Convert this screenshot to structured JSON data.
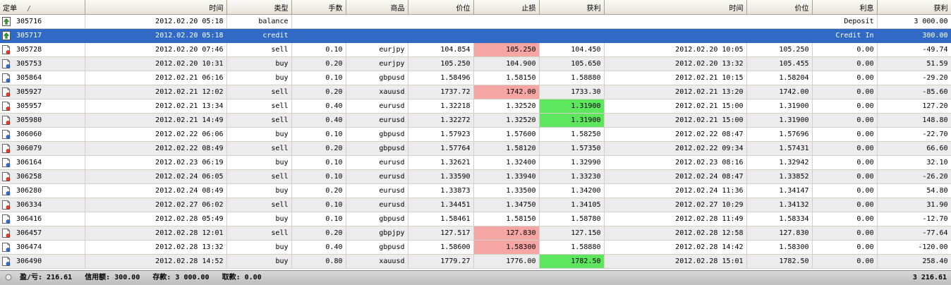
{
  "columns": [
    "定单",
    "时间",
    "类型",
    "手数",
    "商品",
    "价位",
    "止损",
    "获利",
    "时间",
    "价位",
    "利息",
    "获利"
  ],
  "sort_indicator": "/",
  "rows": [
    {
      "icon": "balance",
      "order": "305716",
      "open_time": "2012.02.20 05:18",
      "type": "balance",
      "comment": "Deposit",
      "swap": "",
      "profit": "3 000.00"
    },
    {
      "icon": "balance",
      "order": "305717",
      "open_time": "2012.02.20 05:18",
      "type": "credit",
      "comment": "Credit In",
      "swap": "",
      "profit": "300.00",
      "selected": true
    },
    {
      "icon": "sell",
      "order": "305728",
      "open_time": "2012.02.20 07:46",
      "type": "sell",
      "lots": "0.10",
      "symbol": "eurjpy",
      "price": "104.854",
      "sl": "105.250",
      "tp": "104.450",
      "close_time": "2012.02.20 10:05",
      "close_price": "105.250",
      "swap": "0.00",
      "profit": "-49.74",
      "sl_hl": "red"
    },
    {
      "icon": "buy",
      "order": "305753",
      "open_time": "2012.02.20 10:31",
      "type": "buy",
      "lots": "0.20",
      "symbol": "eurjpy",
      "price": "105.250",
      "sl": "104.900",
      "tp": "105.650",
      "close_time": "2012.02.20 13:32",
      "close_price": "105.455",
      "swap": "0.00",
      "profit": "51.59"
    },
    {
      "icon": "buy",
      "order": "305864",
      "open_time": "2012.02.21 06:16",
      "type": "buy",
      "lots": "0.10",
      "symbol": "gbpusd",
      "price": "1.58496",
      "sl": "1.58150",
      "tp": "1.58880",
      "close_time": "2012.02.21 10:15",
      "close_price": "1.58204",
      "swap": "0.00",
      "profit": "-29.20"
    },
    {
      "icon": "sell",
      "order": "305927",
      "open_time": "2012.02.21 12:02",
      "type": "sell",
      "lots": "0.20",
      "symbol": "xauusd",
      "price": "1737.72",
      "sl": "1742.00",
      "tp": "1733.30",
      "close_time": "2012.02.21 13:20",
      "close_price": "1742.00",
      "swap": "0.00",
      "profit": "-85.60",
      "sl_hl": "red"
    },
    {
      "icon": "sell",
      "order": "305957",
      "open_time": "2012.02.21 13:34",
      "type": "sell",
      "lots": "0.40",
      "symbol": "eurusd",
      "price": "1.32218",
      "sl": "1.32520",
      "tp": "1.31900",
      "close_time": "2012.02.21 15:00",
      "close_price": "1.31900",
      "swap": "0.00",
      "profit": "127.20",
      "tp_hl": "green"
    },
    {
      "icon": "sell",
      "order": "305980",
      "open_time": "2012.02.21 14:49",
      "type": "sell",
      "lots": "0.40",
      "symbol": "eurusd",
      "price": "1.32272",
      "sl": "1.32520",
      "tp": "1.31900",
      "close_time": "2012.02.21 15:00",
      "close_price": "1.31900",
      "swap": "0.00",
      "profit": "148.80",
      "tp_hl": "green"
    },
    {
      "icon": "buy",
      "order": "306060",
      "open_time": "2012.02.22 06:06",
      "type": "buy",
      "lots": "0.10",
      "symbol": "gbpusd",
      "price": "1.57923",
      "sl": "1.57600",
      "tp": "1.58250",
      "close_time": "2012.02.22 08:47",
      "close_price": "1.57696",
      "swap": "0.00",
      "profit": "-22.70"
    },
    {
      "icon": "sell",
      "order": "306079",
      "open_time": "2012.02.22 08:49",
      "type": "sell",
      "lots": "0.20",
      "symbol": "gbpusd",
      "price": "1.57764",
      "sl": "1.58120",
      "tp": "1.57350",
      "close_time": "2012.02.22 09:34",
      "close_price": "1.57431",
      "swap": "0.00",
      "profit": "66.60"
    },
    {
      "icon": "buy",
      "order": "306164",
      "open_time": "2012.02.23 06:19",
      "type": "buy",
      "lots": "0.10",
      "symbol": "eurusd",
      "price": "1.32621",
      "sl": "1.32400",
      "tp": "1.32990",
      "close_time": "2012.02.23 08:16",
      "close_price": "1.32942",
      "swap": "0.00",
      "profit": "32.10"
    },
    {
      "icon": "sell",
      "order": "306258",
      "open_time": "2012.02.24 06:05",
      "type": "sell",
      "lots": "0.10",
      "symbol": "eurusd",
      "price": "1.33590",
      "sl": "1.33940",
      "tp": "1.33230",
      "close_time": "2012.02.24 08:47",
      "close_price": "1.33852",
      "swap": "0.00",
      "profit": "-26.20"
    },
    {
      "icon": "buy",
      "order": "306280",
      "open_time": "2012.02.24 08:49",
      "type": "buy",
      "lots": "0.20",
      "symbol": "eurusd",
      "price": "1.33873",
      "sl": "1.33500",
      "tp": "1.34200",
      "close_time": "2012.02.24 11:36",
      "close_price": "1.34147",
      "swap": "0.00",
      "profit": "54.80"
    },
    {
      "icon": "sell",
      "order": "306334",
      "open_time": "2012.02.27 06:02",
      "type": "sell",
      "lots": "0.10",
      "symbol": "eurusd",
      "price": "1.34451",
      "sl": "1.34750",
      "tp": "1.34105",
      "close_time": "2012.02.27 10:29",
      "close_price": "1.34132",
      "swap": "0.00",
      "profit": "31.90"
    },
    {
      "icon": "buy",
      "order": "306416",
      "open_time": "2012.02.28 05:49",
      "type": "buy",
      "lots": "0.10",
      "symbol": "gbpusd",
      "price": "1.58461",
      "sl": "1.58150",
      "tp": "1.58780",
      "close_time": "2012.02.28 11:49",
      "close_price": "1.58334",
      "swap": "0.00",
      "profit": "-12.70"
    },
    {
      "icon": "sell",
      "order": "306457",
      "open_time": "2012.02.28 12:01",
      "type": "sell",
      "lots": "0.20",
      "symbol": "gbpjpy",
      "price": "127.517",
      "sl": "127.830",
      "tp": "127.150",
      "close_time": "2012.02.28 12:58",
      "close_price": "127.830",
      "swap": "0.00",
      "profit": "-77.64",
      "sl_hl": "red"
    },
    {
      "icon": "buy",
      "order": "306474",
      "open_time": "2012.02.28 13:32",
      "type": "buy",
      "lots": "0.40",
      "symbol": "gbpusd",
      "price": "1.58600",
      "sl": "1.58300",
      "tp": "1.58880",
      "close_time": "2012.02.28 14:42",
      "close_price": "1.58300",
      "swap": "0.00",
      "profit": "-120.00",
      "sl_hl": "red"
    },
    {
      "icon": "buy",
      "order": "306490",
      "open_time": "2012.02.28 14:52",
      "type": "buy",
      "lots": "0.80",
      "symbol": "xauusd",
      "price": "1779.27",
      "sl": "1776.00",
      "tp": "1782.50",
      "close_time": "2012.02.28 15:01",
      "close_price": "1782.50",
      "swap": "0.00",
      "profit": "258.40",
      "tp_hl": "green"
    }
  ],
  "summary": {
    "profit_loss": "盈/亏: 216.61",
    "credit": "信用额: 300.00",
    "deposit": "存款: 3 000.00",
    "withdrawal": "取款: 0.00",
    "total": "3 216.61"
  },
  "colors": {
    "selected_row": "#316ac5",
    "stop_loss_hit": "#f6a5a5",
    "take_profit_hit": "#5ee65e",
    "alt_row": "#ececec"
  }
}
